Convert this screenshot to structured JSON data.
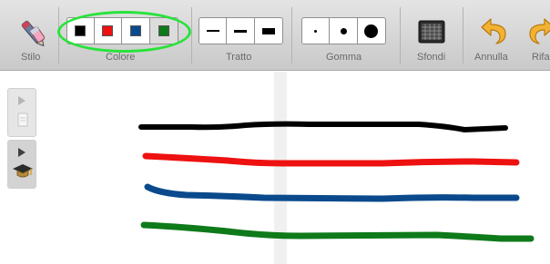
{
  "toolbar": {
    "stilo": {
      "label": "Stilo",
      "icon": "pen-icon"
    },
    "colore": {
      "label": "Colore",
      "swatches": [
        {
          "name": "black",
          "color": "#000000"
        },
        {
          "name": "red",
          "color": "#ee1111"
        },
        {
          "name": "blue",
          "color": "#0a4a8c"
        },
        {
          "name": "green",
          "color": "#0f7a1a"
        }
      ],
      "selected": "green"
    },
    "tratto": {
      "label": "Tratto"
    },
    "gomma": {
      "label": "Gomma"
    },
    "sfondi": {
      "label": "Sfondi",
      "icon": "background-grid-icon"
    },
    "annulla": {
      "label": "Annulla",
      "icon": "undo-arrow-icon"
    },
    "rifai": {
      "label": "Rifa",
      "icon": "redo-arrow-icon"
    },
    "highlight_color": "#27e33a"
  },
  "sidebar": {
    "items": [
      {
        "icon": "page-icon"
      },
      {
        "icon": "graduation-cap-icon"
      }
    ]
  },
  "strokes": [
    {
      "name": "black-stroke",
      "color": "#000000"
    },
    {
      "name": "red-stroke",
      "color": "#ee1111"
    },
    {
      "name": "blue-stroke",
      "color": "#0a4a8c"
    },
    {
      "name": "green-stroke",
      "color": "#0f7a1a"
    }
  ]
}
